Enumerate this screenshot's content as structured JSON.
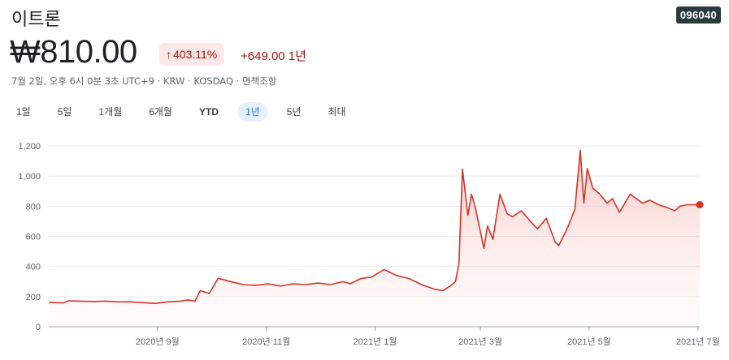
{
  "header": {
    "title": "이트론",
    "ticker": "096040",
    "price": "₩810.00",
    "change_pct": "403.11%",
    "change_arrow_icon": "arrow-up-icon",
    "change_abs": "+649.00 1년",
    "meta": "7월 2일, 오후 6시 0분 3초 UTC+9 · KRW · KOSDAQ · 면책조항"
  },
  "tabs": [
    {
      "label": "1일"
    },
    {
      "label": "5일"
    },
    {
      "label": "1개월"
    },
    {
      "label": "6개월"
    },
    {
      "label": "YTD"
    },
    {
      "label": "1년",
      "active": true
    },
    {
      "label": "5년"
    },
    {
      "label": "최대"
    }
  ],
  "colors": {
    "line": "#d93025",
    "fill": "#fce8e6",
    "positive_text": "#a50e0e",
    "active_tab": "#1a73e8"
  },
  "chart_data": {
    "type": "area",
    "title": "",
    "xlabel": "",
    "ylabel": "",
    "ylim": [
      0,
      1200
    ],
    "y_ticks": [
      "0",
      "200",
      "400",
      "600",
      "800",
      "1,000",
      "1,200"
    ],
    "x_ticks": [
      {
        "label": "2020년 9월",
        "date": "2020-09-01"
      },
      {
        "label": "2020년 11월",
        "date": "2020-11-01"
      },
      {
        "label": "2021년 1월",
        "date": "2021-01-01"
      },
      {
        "label": "2021년 3월",
        "date": "2021-03-01"
      },
      {
        "label": "2021년 5월",
        "date": "2021-05-01"
      },
      {
        "label": "2021년 7월",
        "date": "2021-07-01"
      }
    ],
    "x_range": [
      "2020-07-02",
      "2021-07-02"
    ],
    "grid": true,
    "series": [
      {
        "x": [
          "2020-07-02",
          "2020-07-10",
          "2020-07-13",
          "2020-07-20",
          "2020-07-27",
          "2020-08-03",
          "2020-08-10",
          "2020-08-17",
          "2020-08-24",
          "2020-08-31",
          "2020-09-07",
          "2020-09-14",
          "2020-09-18",
          "2020-09-22",
          "2020-09-25",
          "2020-09-30",
          "2020-10-05",
          "2020-10-12",
          "2020-10-19",
          "2020-10-26",
          "2020-11-02",
          "2020-11-09",
          "2020-11-16",
          "2020-11-23",
          "2020-11-30",
          "2020-12-07",
          "2020-12-14",
          "2020-12-18",
          "2020-12-24",
          "2020-12-30",
          "2021-01-06",
          "2021-01-13",
          "2021-01-20",
          "2021-01-27",
          "2021-02-03",
          "2021-02-08",
          "2021-02-12",
          "2021-02-15",
          "2021-02-17",
          "2021-02-19",
          "2021-02-22",
          "2021-02-24",
          "2021-02-26",
          "2021-03-03",
          "2021-03-05",
          "2021-03-08",
          "2021-03-12",
          "2021-03-16",
          "2021-03-19",
          "2021-03-24",
          "2021-03-29",
          "2021-04-02",
          "2021-04-07",
          "2021-04-12",
          "2021-04-14",
          "2021-04-19",
          "2021-04-23",
          "2021-04-26",
          "2021-04-28",
          "2021-04-30",
          "2021-05-03",
          "2021-05-07",
          "2021-05-11",
          "2021-05-14",
          "2021-05-18",
          "2021-05-24",
          "2021-05-31",
          "2021-06-04",
          "2021-06-09",
          "2021-06-14",
          "2021-06-18",
          "2021-06-21",
          "2021-06-25",
          "2021-07-02"
        ],
        "values": [
          162,
          158,
          172,
          170,
          168,
          170,
          166,
          165,
          160,
          155,
          165,
          170,
          178,
          170,
          240,
          220,
          322,
          300,
          280,
          275,
          285,
          270,
          285,
          280,
          290,
          280,
          300,
          285,
          320,
          330,
          380,
          340,
          320,
          280,
          250,
          240,
          270,
          300,
          420,
          1045,
          740,
          880,
          800,
          520,
          670,
          580,
          880,
          750,
          730,
          770,
          700,
          650,
          720,
          560,
          540,
          660,
          780,
          1170,
          820,
          1050,
          920,
          880,
          820,
          850,
          760,
          880,
          820,
          840,
          810,
          790,
          770,
          800,
          810,
          810
        ]
      }
    ]
  }
}
